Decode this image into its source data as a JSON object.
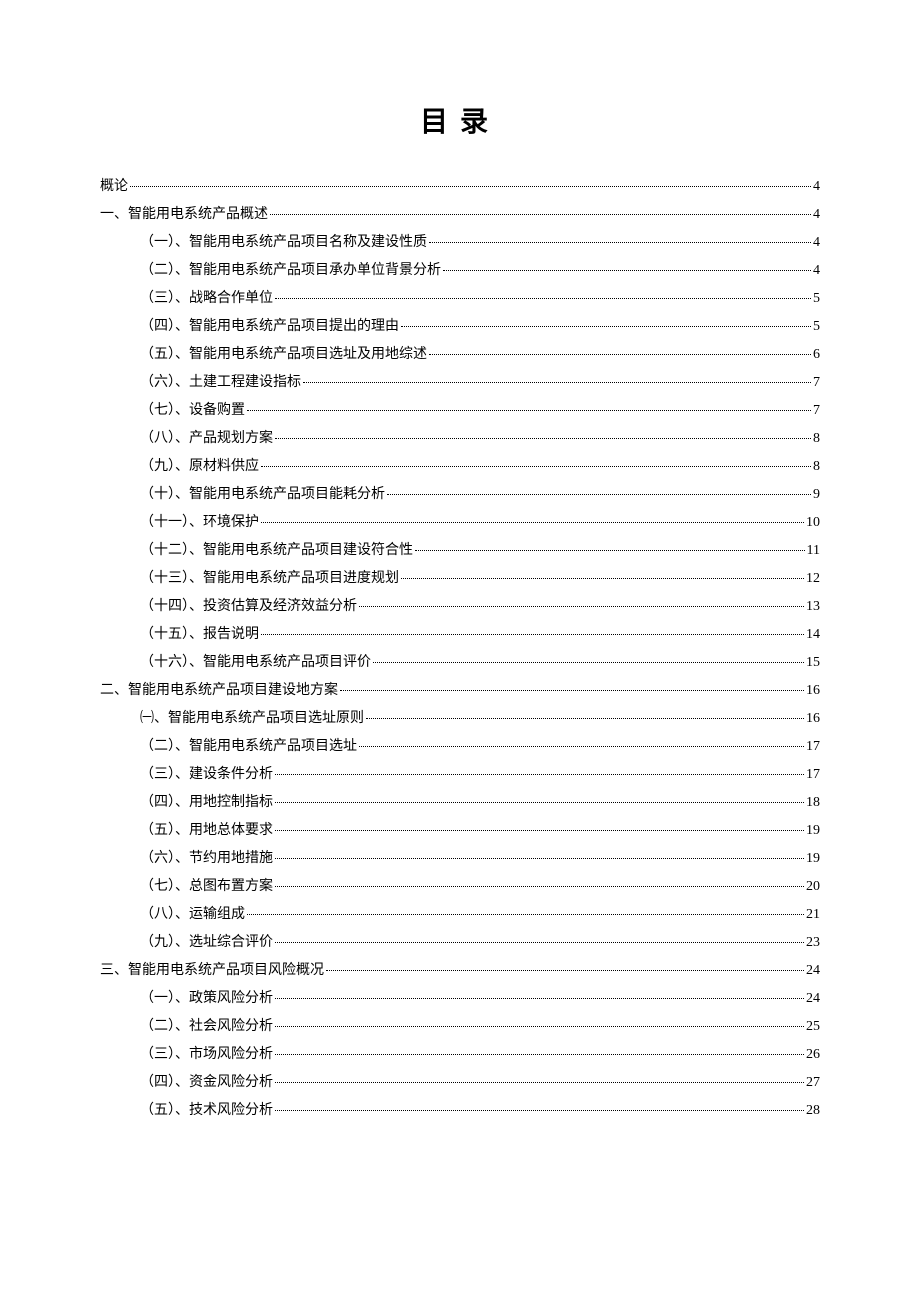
{
  "title": "目录",
  "entries": [
    {
      "level": 0,
      "label": "概论",
      "page": "4"
    },
    {
      "level": 1,
      "label": "一、智能用电系统产品概述",
      "page": "4"
    },
    {
      "level": 2,
      "label": "（一）、智能用电系统产品项目名称及建设性质",
      "page": "4"
    },
    {
      "level": 2,
      "label": "（二）、智能用电系统产品项目承办单位背景分析",
      "page": "4"
    },
    {
      "level": 2,
      "label": "（三）、战略合作单位",
      "page": "5"
    },
    {
      "level": 2,
      "label": "（四）、智能用电系统产品项目提出的理由",
      "page": "5"
    },
    {
      "level": 2,
      "label": "（五）、智能用电系统产品项目选址及用地综述",
      "page": "6"
    },
    {
      "level": 2,
      "label": "（六）、土建工程建设指标",
      "page": "7"
    },
    {
      "level": 2,
      "label": "（七）、设备购置",
      "page": "7"
    },
    {
      "level": 2,
      "label": "（八）、产品规划方案",
      "page": "8"
    },
    {
      "level": 2,
      "label": "（九）、原材料供应",
      "page": "8"
    },
    {
      "level": 2,
      "label": "（十）、智能用电系统产品项目能耗分析",
      "page": "9"
    },
    {
      "level": 2,
      "label": "（十一）、环境保护",
      "page": "10"
    },
    {
      "level": 2,
      "label": "（十二）、智能用电系统产品项目建设符合性",
      "page": "11"
    },
    {
      "level": 2,
      "label": "（十三）、智能用电系统产品项目进度规划",
      "page": "12"
    },
    {
      "level": 2,
      "label": "（十四）、投资估算及经济效益分析",
      "page": "13"
    },
    {
      "level": 2,
      "label": "（十五）、报告说明",
      "page": "14"
    },
    {
      "level": 2,
      "label": "（十六）、智能用电系统产品项目评价",
      "page": "15"
    },
    {
      "level": 1,
      "label": "二、智能用电系统产品项目建设地方案",
      "page": "16"
    },
    {
      "level": 2,
      "label": "㈠、智能用电系统产品项目选址原则",
      "page": "16"
    },
    {
      "level": 2,
      "label": "（二）、智能用电系统产品项目选址",
      "page": "17"
    },
    {
      "level": 2,
      "label": "（三）、建设条件分析",
      "page": "17"
    },
    {
      "level": 2,
      "label": "（四）、用地控制指标",
      "page": "18"
    },
    {
      "level": 2,
      "label": "（五）、用地总体要求",
      "page": "19"
    },
    {
      "level": 2,
      "label": "（六）、节约用地措施",
      "page": "19"
    },
    {
      "level": 2,
      "label": "（七）、总图布置方案",
      "page": "20"
    },
    {
      "level": 2,
      "label": "（八）、运输组成",
      "page": "21"
    },
    {
      "level": 2,
      "label": "（九）、选址综合评价",
      "page": "23"
    },
    {
      "level": 1,
      "label": "三、智能用电系统产品项目风险概况",
      "page": "24"
    },
    {
      "level": 2,
      "label": "（一）、政策风险分析",
      "page": "24"
    },
    {
      "level": 2,
      "label": "（二）、社会风险分析",
      "page": "25"
    },
    {
      "level": 2,
      "label": "（三）、市场风险分析",
      "page": "26"
    },
    {
      "level": 2,
      "label": "（四）、资金风险分析",
      "page": "27"
    },
    {
      "level": 2,
      "label": "（五）、技术风险分析",
      "page": "28"
    }
  ]
}
